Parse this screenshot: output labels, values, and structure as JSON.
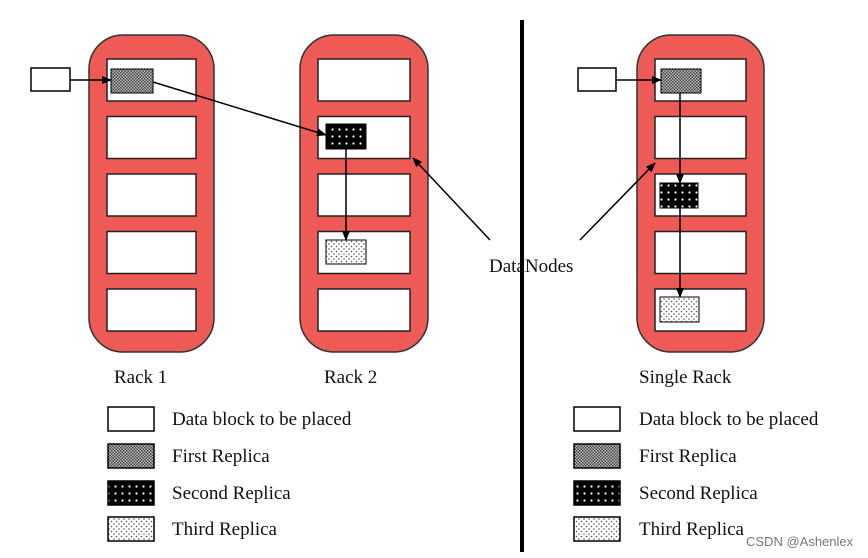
{
  "colors": {
    "rack": "#ee5b57",
    "rack_border": "#333333",
    "slot": "#ffffff",
    "line": "#000000"
  },
  "racks": [
    {
      "label": "Rack 1"
    },
    {
      "label": "Rack 2"
    },
    {
      "label": "Single Rack"
    }
  ],
  "callout": "DataNodes",
  "legend": [
    {
      "label": "Data block to be placed",
      "pattern": "blank"
    },
    {
      "label": "First Replica",
      "pattern": "gray-checker"
    },
    {
      "label": "Second Replica",
      "pattern": "black-dotted"
    },
    {
      "label": "Third Replica",
      "pattern": "light-dotted"
    }
  ],
  "watermark": "CSDN @Ashenlex"
}
